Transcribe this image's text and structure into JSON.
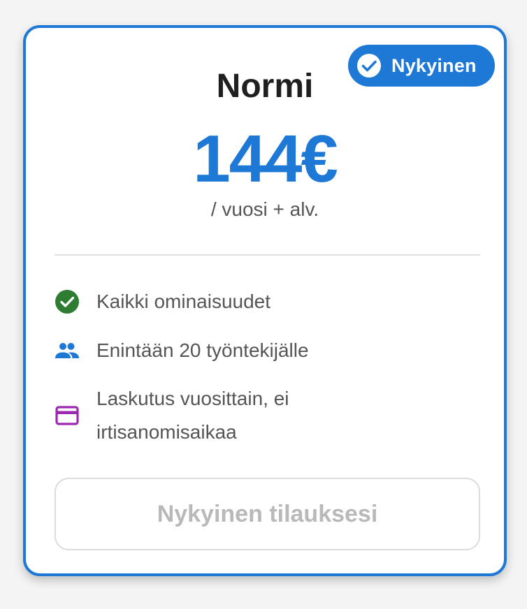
{
  "plan": {
    "name": "Normi",
    "price": "144€",
    "period": "/ vuosi + alv."
  },
  "badge": {
    "label": "Nykyinen",
    "icon": "check-circle-icon"
  },
  "features": [
    {
      "icon": "check-circle-icon",
      "color": "#2e7d32",
      "text": "Kaikki ominaisuudet"
    },
    {
      "icon": "people-icon",
      "color": "#1e78d6",
      "text": "Enintään 20 työntekijälle"
    },
    {
      "icon": "credit-card-icon",
      "color": "#9c27b0",
      "text": "Laskutus vuosittain, ei irtisanomisaikaa"
    }
  ],
  "cta": {
    "label": "Nykyinen tilauksesi"
  },
  "colors": {
    "accent": "#1e78d6",
    "success": "#2e7d32",
    "purple": "#9c27b0",
    "disabled_text": "#b9b9b9"
  }
}
